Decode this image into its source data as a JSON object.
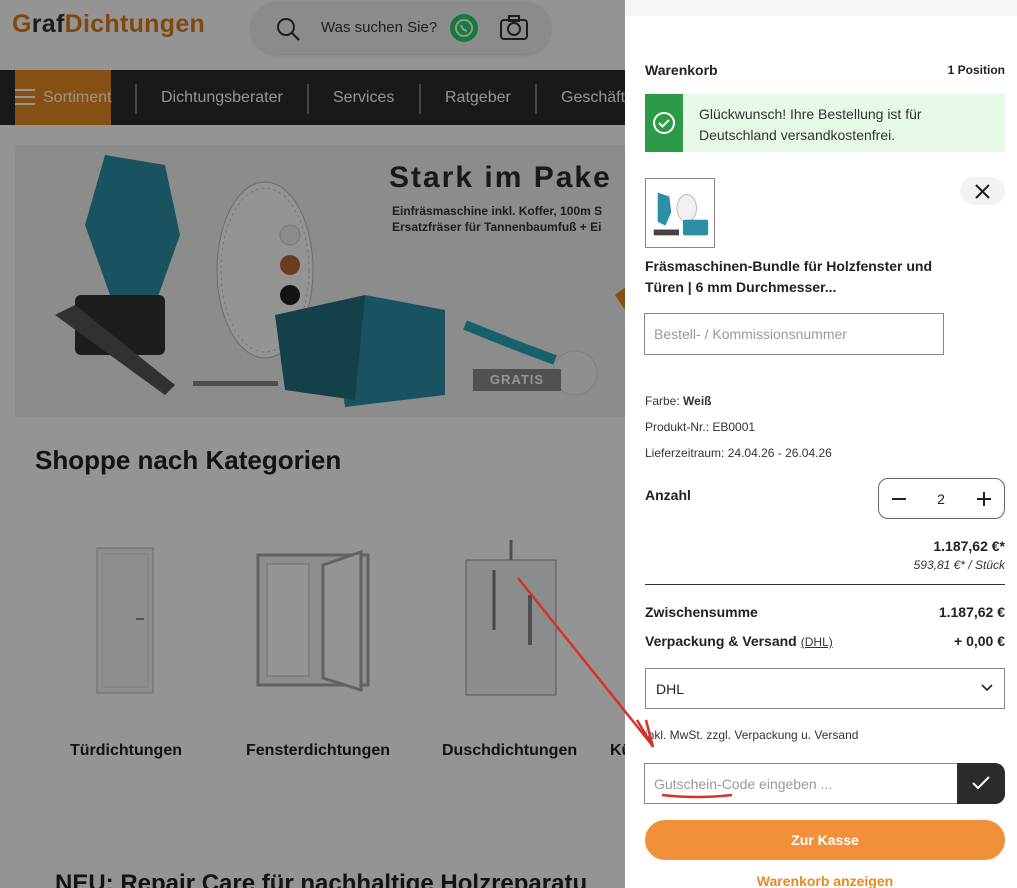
{
  "header": {
    "logo_g": "G",
    "logo_raf": "raf",
    "logo_dicht": "Dichtungen",
    "search_placeholder": "Was suchen Sie?"
  },
  "nav": {
    "sortiment": "Sortiment",
    "items": [
      "Dichtungsberater",
      "Services",
      "Ratgeber",
      "Geschäft"
    ]
  },
  "hero": {
    "title": "Stark im Pake",
    "sub_line1": "Einfräsmaschine inkl. Koffer, 100m S",
    "sub_line2": "Ersatzfräser für Tannenbaumfuß + Ei",
    "badge": "GRATIS"
  },
  "categories": {
    "title": "Shoppe nach Kategorien",
    "items": [
      "Türdichtungen",
      "Fensterdichtungen",
      "Duschdichtungen",
      "Kü"
    ]
  },
  "teaser": "NEU: Repair Care für nachhaltige Holzreparatu",
  "cart": {
    "title": "Warenkorb",
    "count": "1 Position",
    "alert": "Glückwunsch! Ihre Bestellung ist für Deutschland versandkostenfrei.",
    "product_name": "Fräsmaschinen-Bundle für Holzfenster und Türen | 6 mm Durchmesser...",
    "kommission_placeholder": "Bestell- / Kommissionsnummer",
    "farbe_label": "Farbe:",
    "farbe_value": "Weiß",
    "produkt_label": "Produkt-Nr.:",
    "produkt_value": "EB0001",
    "liefer_label": "Lieferzeitraum:",
    "liefer_value": "24.04.26 - 26.04.26",
    "anzahl_label": "Anzahl",
    "quantity": "2",
    "price": "1.187,62 €*",
    "unit_price": "593,81 €* / Stück",
    "subtotal_label": "Zwischensumme",
    "subtotal_value": "1.187,62 €",
    "shipping_label": "Verpackung & Versand",
    "shipping_link": "(DHL)",
    "shipping_value": "+ 0,00 €",
    "shipping_method": "DHL",
    "tax_note": "inkl. MwSt. zzgl. Verpackung u. Versand",
    "coupon_placeholder": "Gutschein-Code eingeben ...",
    "checkout_label": "Zur Kasse",
    "view_cart_label": "Warenkorb anzeigen"
  },
  "colors": {
    "brand_orange": "#e68a1e",
    "nav_dark": "#2b2b2b",
    "success_green": "#2c9a47",
    "annotation_red": "#d9312a"
  }
}
